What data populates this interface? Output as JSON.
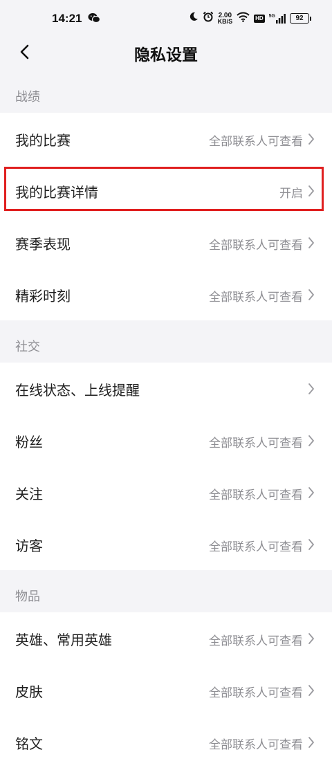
{
  "status_bar": {
    "time": "14:21",
    "net_speed_value": "2.00",
    "net_speed_unit": "KB/S",
    "hd_label": "HD",
    "signal_label": "5G",
    "battery": "92"
  },
  "header": {
    "title": "隐私设置"
  },
  "sections": [
    {
      "title": "战绩",
      "items": [
        {
          "label": "我的比赛",
          "value": "全部联系人可查看"
        },
        {
          "label": "我的比赛详情",
          "value": "开启"
        },
        {
          "label": "赛季表现",
          "value": "全部联系人可查看"
        },
        {
          "label": "精彩时刻",
          "value": "全部联系人可查看"
        }
      ]
    },
    {
      "title": "社交",
      "items": [
        {
          "label": "在线状态、上线提醒",
          "value": ""
        },
        {
          "label": "粉丝",
          "value": "全部联系人可查看"
        },
        {
          "label": "关注",
          "value": "全部联系人可查看"
        },
        {
          "label": "访客",
          "value": "全部联系人可查看"
        }
      ]
    },
    {
      "title": "物品",
      "items": [
        {
          "label": "英雄、常用英雄",
          "value": "全部联系人可查看"
        },
        {
          "label": "皮肤",
          "value": "全部联系人可查看"
        },
        {
          "label": "铭文",
          "value": "全部联系人可查看"
        }
      ]
    }
  ],
  "colors": {
    "background": "#f4f4f7",
    "row_background": "#ffffff",
    "secondary_text": "#8e8e93",
    "highlight_border": "#e02020"
  }
}
